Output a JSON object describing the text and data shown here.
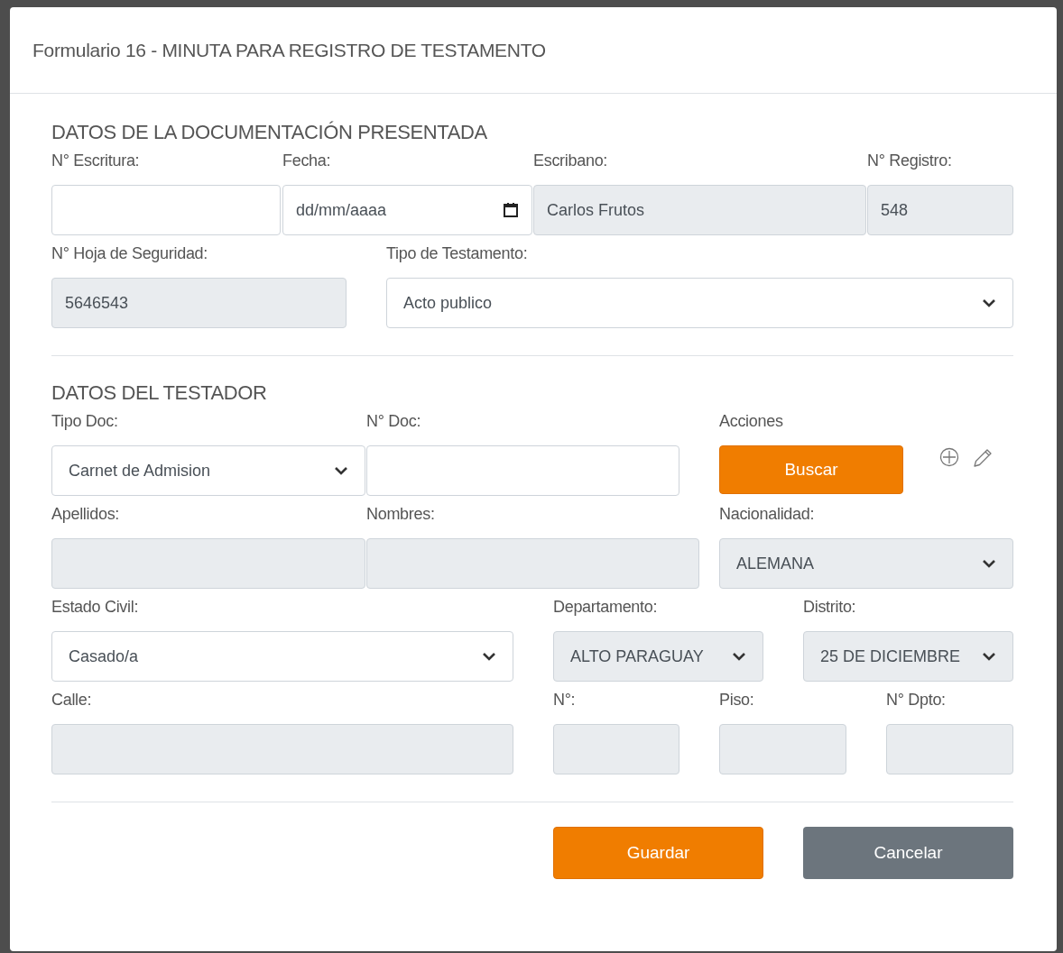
{
  "modal": {
    "title": "Formulario 16 - MINUTA PARA REGISTRO DE TESTAMENTO"
  },
  "sections": [
    {
      "title": "DATOS DE LA DOCUMENTACIÓN PRESENTADA",
      "rows": [
        [
          {
            "kind": "text",
            "label": "N° Escritura:",
            "disabled": false
          },
          {
            "kind": "date",
            "label": "Fecha:",
            "placeholder": "dd/mm/aaaa",
            "disabled": false
          },
          {
            "kind": "text",
            "label": "Escribano:",
            "value": "Carlos Frutos",
            "disabled": true
          },
          {
            "kind": "text",
            "label": "N° Registro:",
            "value": "548",
            "disabled": true
          }
        ],
        [
          {
            "kind": "text",
            "label": "N° Hoja de Seguridad:",
            "value": "5646543",
            "disabled": true
          },
          {
            "kind": "select",
            "label": "Tipo de Testamento:",
            "value": "Acto publico",
            "disabled": false
          }
        ]
      ]
    },
    {
      "title": "DATOS DEL TESTADOR",
      "rows": [
        [
          {
            "kind": "select",
            "label": "Tipo Doc:",
            "value": "Carnet de Admision",
            "disabled": false
          },
          {
            "kind": "text",
            "label": "N° Doc:",
            "disabled": false
          },
          {
            "kind": "actions",
            "label": "Acciones",
            "button": "Buscar"
          }
        ],
        [
          {
            "kind": "text",
            "label": "Apellidos:",
            "disabled": true
          },
          {
            "kind": "text",
            "label": "Nombres:",
            "disabled": true
          },
          {
            "kind": "select",
            "label": "Nacionalidad:",
            "value": "ALEMANA",
            "disabled": true
          }
        ],
        [
          {
            "kind": "select",
            "label": "Estado Civil:",
            "value": "Casado/a",
            "disabled": false
          },
          {
            "kind": "select",
            "label": "Departamento:",
            "value": "ALTO PARAGUAY",
            "disabled": true
          },
          {
            "kind": "select",
            "label": "Distrito:",
            "value": "25 DE DICIEMBRE",
            "disabled": true
          }
        ],
        [
          {
            "kind": "text",
            "label": "Calle:",
            "disabled": true
          },
          {
            "kind": "text",
            "label": "N°:",
            "disabled": true
          },
          {
            "kind": "text",
            "label": "Piso:",
            "disabled": true
          },
          {
            "kind": "text",
            "label": "N° Dpto:",
            "disabled": true
          }
        ]
      ]
    }
  ],
  "footer": {
    "buttons": [
      {
        "label": "Guardar",
        "kind": "primary"
      },
      {
        "label": "Cancelar",
        "kind": "secondary"
      }
    ]
  }
}
